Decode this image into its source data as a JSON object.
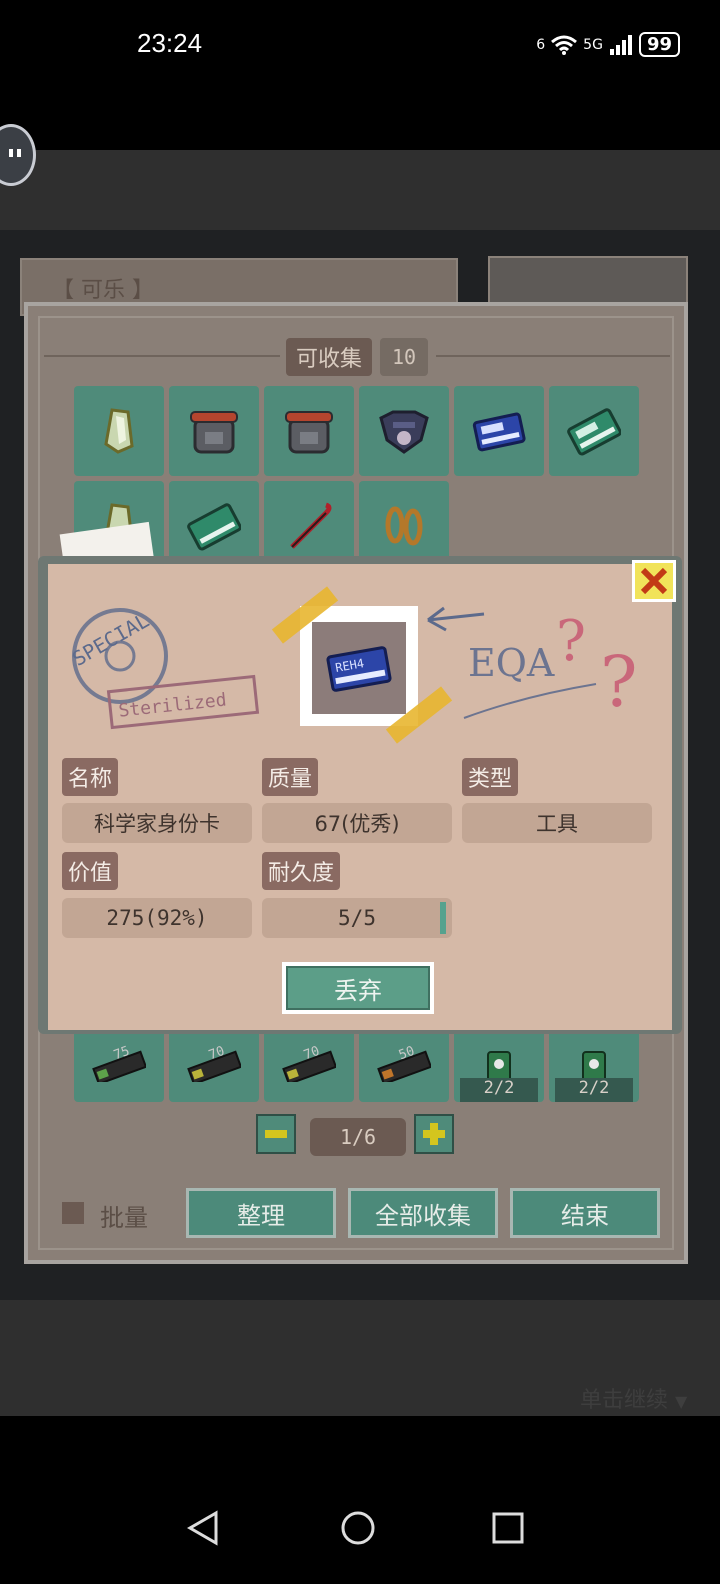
{
  "status_bar": {
    "time": "23:24",
    "network_1": "6",
    "network_2": "5G",
    "battery": "99"
  },
  "background": {
    "name_label": "【 可乐 】",
    "tap_to_continue": "单击继续"
  },
  "inventory": {
    "header_label": "可收集",
    "header_count": "10",
    "slots_row1": [
      "glass-shard-icon",
      "backpack-icon",
      "backpack-icon",
      "gas-mask-icon",
      "blue-id-card-icon",
      "green-id-card-icon"
    ],
    "slots_row2": [
      "glass-shard-icon",
      "green-id-card-icon",
      "crowbar-icon",
      "chain-icon"
    ],
    "bottom_slots": [
      {
        "icon": "ration-bar-icon",
        "label": "75"
      },
      {
        "icon": "ration-bar-icon",
        "label": "70"
      },
      {
        "icon": "ration-bar-icon",
        "label": "70"
      },
      {
        "icon": "ration-bar-icon",
        "label": "50"
      },
      {
        "icon": "bottle-icon",
        "qty": "2/2"
      },
      {
        "icon": "bottle-icon",
        "qty": "2/2"
      }
    ],
    "page": "1/6",
    "batch_label": "批量",
    "buttons": {
      "sort": "整理",
      "collect_all": "全部收集",
      "end": "结束"
    }
  },
  "detail": {
    "stamp_text": "SPECIAL",
    "stamp_sub": "Sterilized",
    "scribble": "EQA",
    "card_text": "REH4",
    "fields": {
      "name_label": "名称",
      "name_value": "科学家身份卡",
      "quality_label": "质量",
      "quality_value": "67(优秀)",
      "type_label": "类型",
      "type_value": "工具",
      "value_label": "价值",
      "value_value": "275(92%)",
      "durability_label": "耐久度",
      "durability_value": "5/5"
    },
    "discard_label": "丢弃"
  },
  "colors": {
    "slot": "#4f8b7a",
    "panel": "#8a7f77",
    "card": "#d5b9a7",
    "accent_yellow": "#f1e35a"
  }
}
